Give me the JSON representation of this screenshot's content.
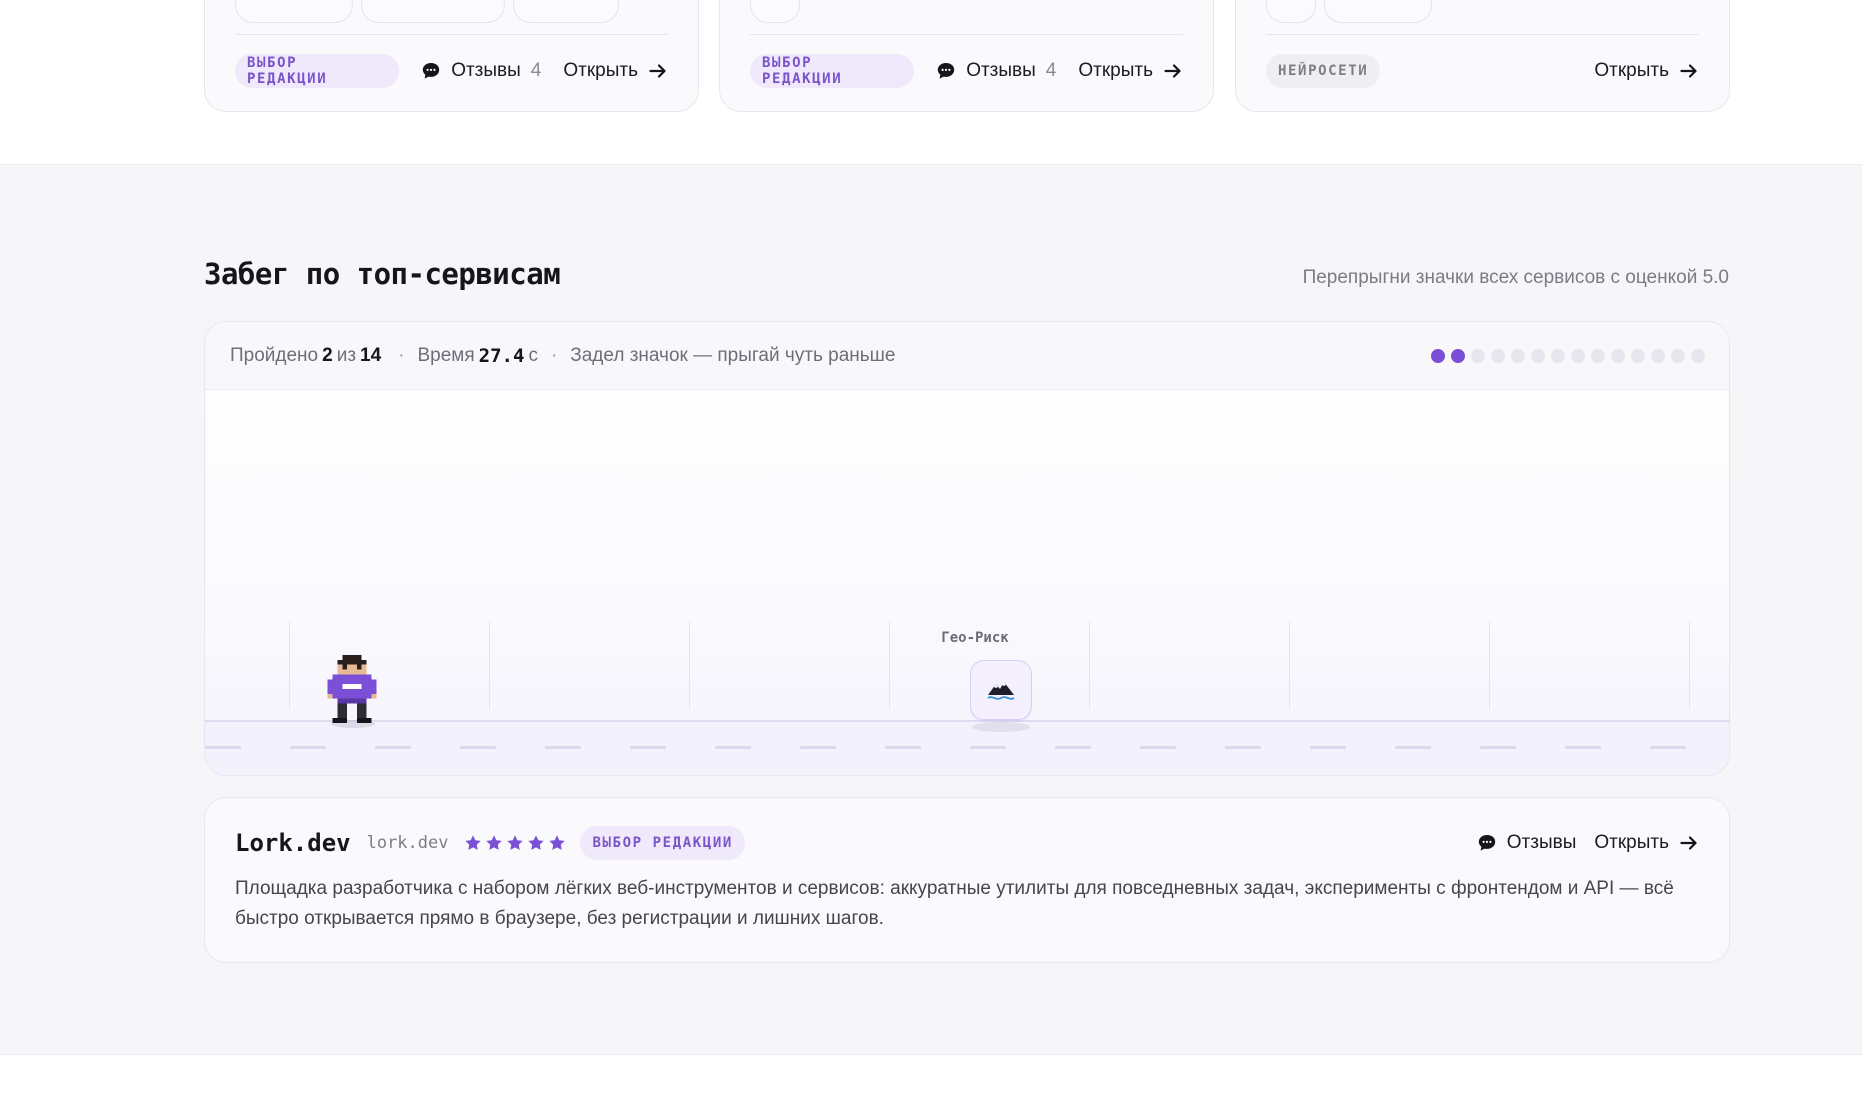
{
  "top_cards": [
    {
      "badge": "ВЫБОР РЕДАКЦИИ",
      "reviews_label": "Отзывы",
      "reviews_count": "4",
      "open_label": "Открыть"
    },
    {
      "badge": "ВЫБОР РЕДАКЦИИ",
      "reviews_label": "Отзывы",
      "reviews_count": "4",
      "open_label": "Открыть"
    },
    {
      "badge": "НЕЙРОСЕТИ",
      "open_label": "Открыть"
    }
  ],
  "section": {
    "title": "Забег по топ-сервисам",
    "subtitle": "Перепрыгни значки всех сервисов с оценкой 5.0"
  },
  "game": {
    "passed_label": "Пройдено",
    "passed": "2",
    "of_label": "из",
    "total": "14",
    "separator": "·",
    "time_label": "Время",
    "time_value": "27.4",
    "time_unit": "с",
    "hint": "Задел значок — прыгай чуть раньше",
    "progress_done": 2,
    "progress_total": 14,
    "obstacle_label": "Гео-Риск",
    "obstacle_icon": "mountain-wave-icon",
    "runner_icon": "pixel-runner-icon",
    "accent_color": "#7b4fd6"
  },
  "service": {
    "name": "Lork.dev",
    "domain": "lork.dev",
    "rating": 5,
    "badge": "ВЫБОР РЕДАКЦИИ",
    "reviews_label": "Отзывы",
    "open_label": "Открыть",
    "description": "Площадка разработчика с набором лёгких веб-инструментов и сервисов: аккуратные утилиты для повседневных задач, эксперименты с фронтендом и API — всё быстро открывается прямо в браузере, без регистрации и лишних шагов."
  }
}
